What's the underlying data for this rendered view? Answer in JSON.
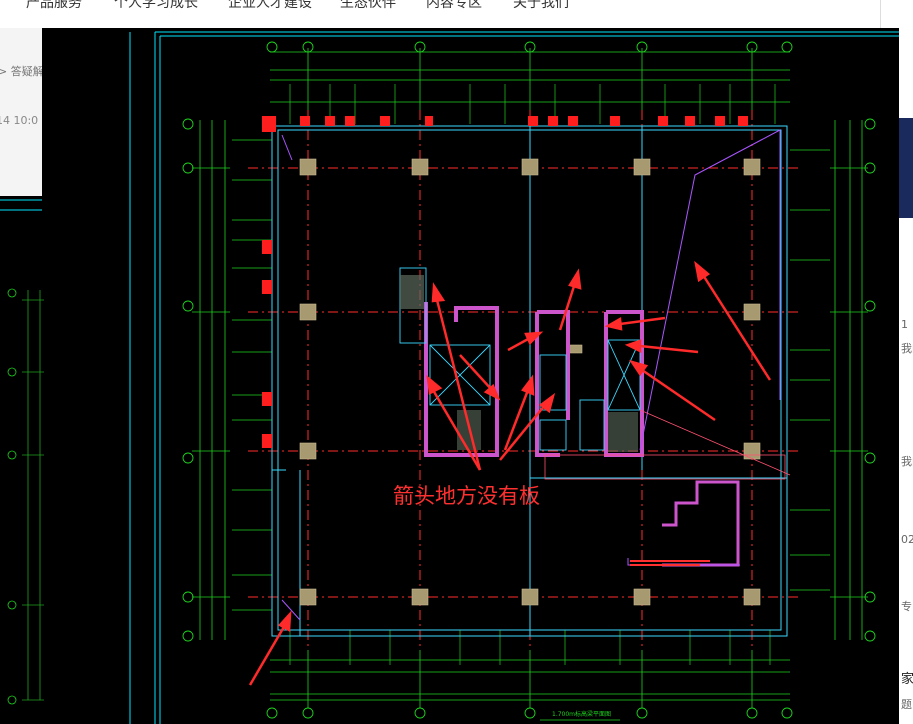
{
  "nav": {
    "items": [
      "产品服务",
      "个人学习成长",
      "企业人才建设",
      "生态伙伴",
      "内容专区",
      "关于我们"
    ]
  },
  "left_panel": {
    "breadcrumb": "> 答疑解",
    "timestamp": "-14 10:0"
  },
  "right_panel": {
    "snippets": [
      "1",
      "我的",
      "我的",
      "02",
      "专",
      "家",
      "题"
    ]
  },
  "drawing": {
    "annotation": "箭头地方没有板",
    "sheet_title": "1.700m标高梁平面图",
    "colors": {
      "background": "#000000",
      "frame": "#00e5ff",
      "dimension": "#1fd11f",
      "grid_axis": "#ff2b2b",
      "wall": "#cc55cc",
      "column": "#b0a080",
      "arrow": "#ff2a2a",
      "note_text": "#ff3030"
    }
  }
}
